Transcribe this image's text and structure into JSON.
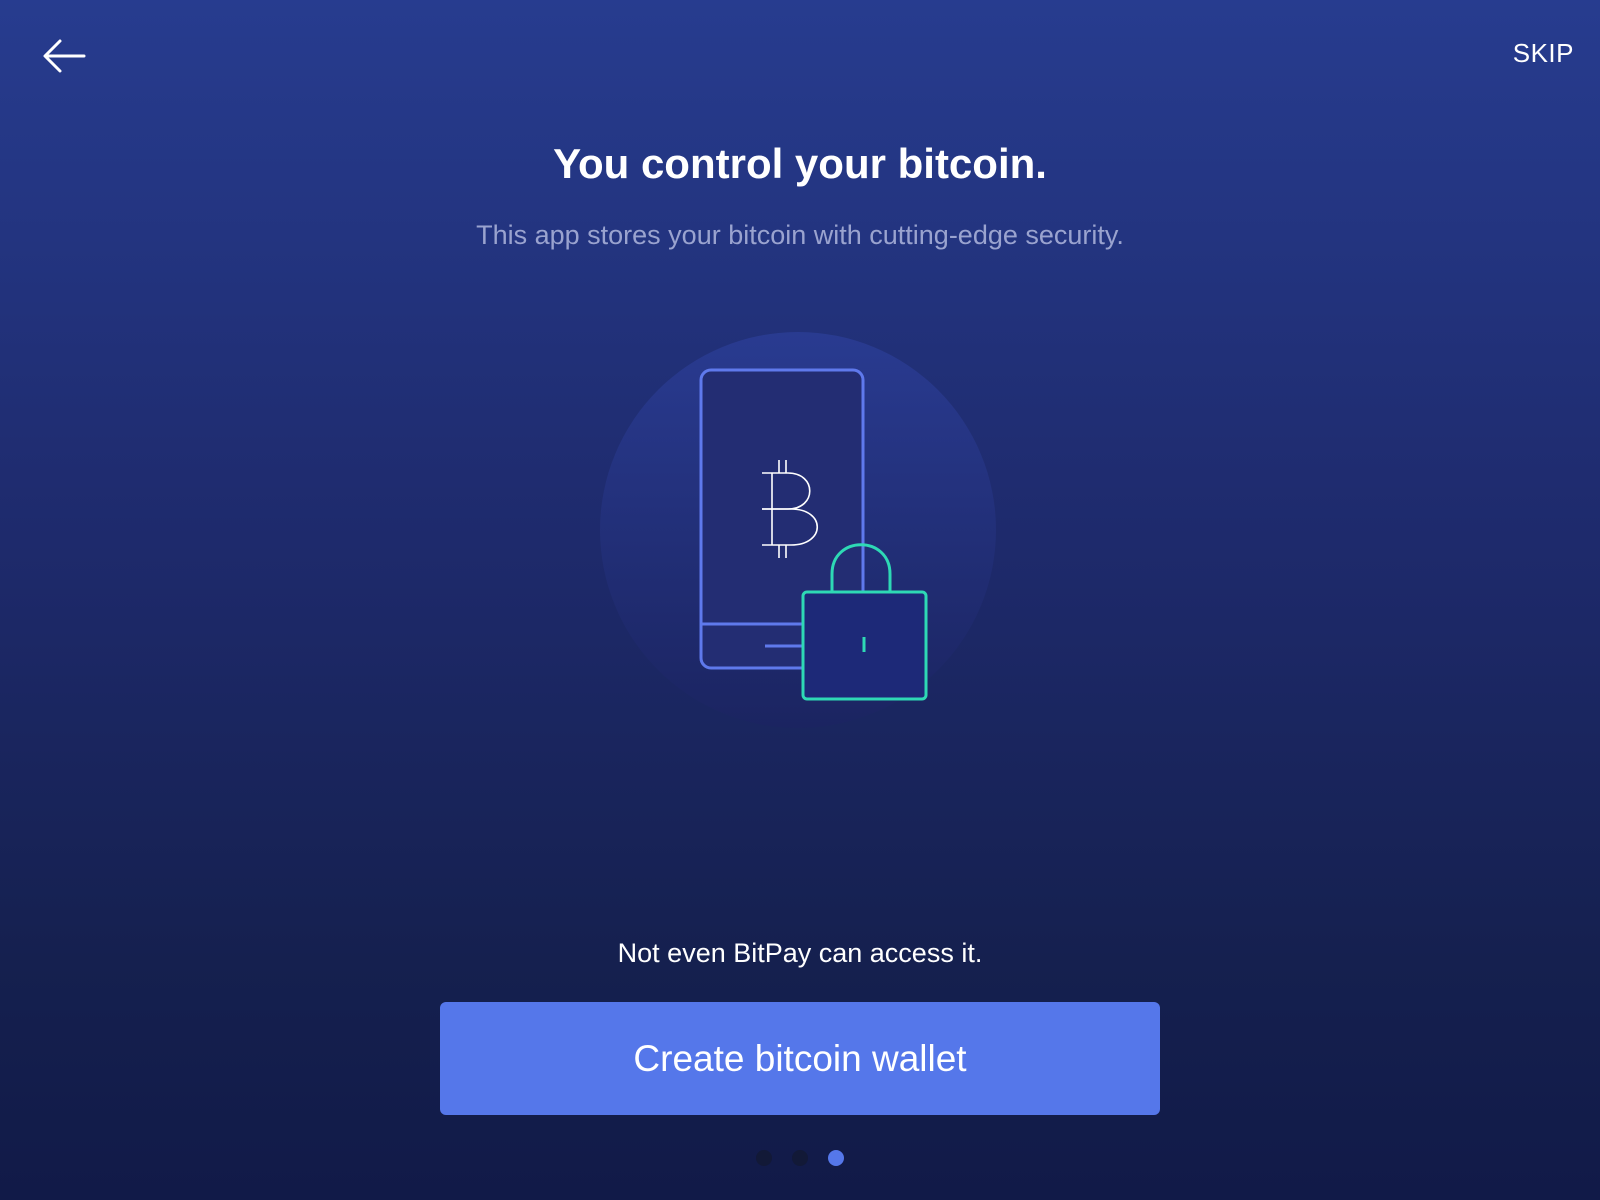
{
  "header": {
    "back_icon": "arrow-left-icon",
    "skip_label": "SKIP"
  },
  "content": {
    "title": "You control your bitcoin.",
    "subtitle": "This app stores your bitcoin with cutting-edge security.",
    "illustration_icons": [
      "phone-icon",
      "bitcoin-icon",
      "padlock-icon"
    ],
    "note": "Not even BitPay can access it."
  },
  "actions": {
    "primary_label": "Create bitcoin wallet"
  },
  "pager": {
    "total": 3,
    "active_index": 2
  },
  "colors": {
    "background_top": "#273c8f",
    "background_bottom": "#111a48",
    "accent": "#5577ea",
    "lock_accent": "#2ed9b5",
    "subtitle_text": "#9aa3cf"
  }
}
